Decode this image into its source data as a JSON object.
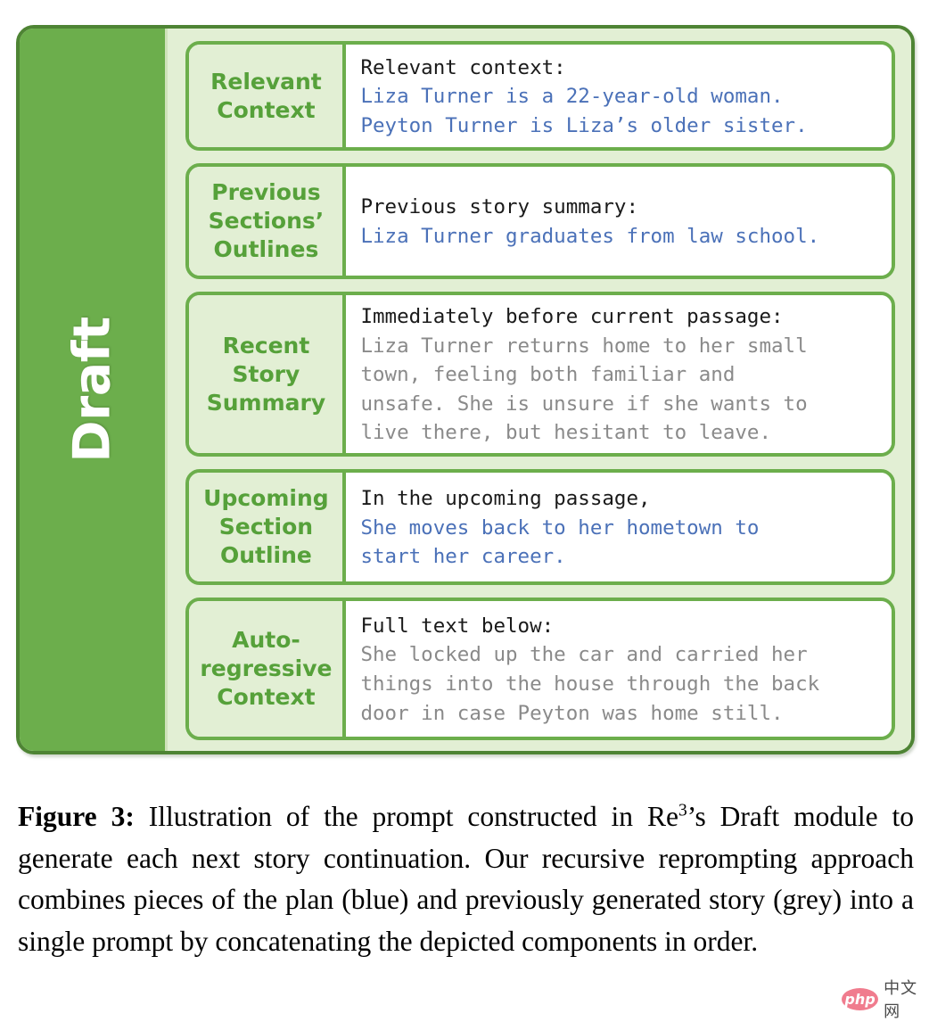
{
  "figure": {
    "sidebar_label": "Draft",
    "rows": [
      {
        "name": "relevant-context",
        "label_lines": [
          "Relevant",
          "Context"
        ],
        "header": "Relevant context:",
        "plan_lines": [
          "Liza Turner is a 22-year-old woman.",
          "Peyton Turner is Liza’s older sister."
        ],
        "story_lines": []
      },
      {
        "name": "previous-sections-outlines",
        "label_lines": [
          "Previous",
          "Sections’",
          "Outlines"
        ],
        "header": "Previous story summary:",
        "plan_lines": [
          "Liza Turner graduates from law school."
        ],
        "story_lines": []
      },
      {
        "name": "recent-story-summary",
        "label_lines": [
          "Recent",
          "Story",
          "Summary"
        ],
        "header": "Immediately before current passage:",
        "plan_lines": [],
        "story_lines": [
          "Liza Turner returns home to her small",
          "town, feeling both familiar and",
          "unsafe. She is unsure if she wants to",
          "live there, but hesitant to leave."
        ]
      },
      {
        "name": "upcoming-section-outline",
        "label_lines": [
          "Upcoming",
          "Section",
          "Outline"
        ],
        "header": "In the upcoming passage,",
        "plan_lines": [
          "She moves back to her hometown to",
          "start her career."
        ],
        "story_lines": []
      },
      {
        "name": "auto-regressive-context",
        "label_lines": [
          "Auto-",
          "regressive",
          "Context"
        ],
        "header": "Full text below:",
        "plan_lines": [],
        "story_lines": [
          "She locked up the car and carried her",
          "things into the house through the back",
          "door in case Peyton was home still."
        ]
      }
    ]
  },
  "caption": {
    "lead": "Figure 3:",
    "part1": " Illustration of the prompt constructed in Re",
    "superscript": "3",
    "part2": "’s Draft module to generate each next story continuation. Our recursive reprompting approach combines pieces of the plan (blue) and previously generated story (grey) into a single prompt by concatenating the depicted components in order."
  },
  "watermark": {
    "badge": "php",
    "text": "中文网"
  },
  "colors": {
    "band_green": "#6cae4c",
    "panel_green": "#e2efd4",
    "border_green": "#4e8434",
    "label_green": "#56a13a",
    "plan_blue": "#4b71b8",
    "story_grey": "#8a8a8a",
    "header_black": "#1a1a1a",
    "watermark_pink": "#f07c8e"
  }
}
